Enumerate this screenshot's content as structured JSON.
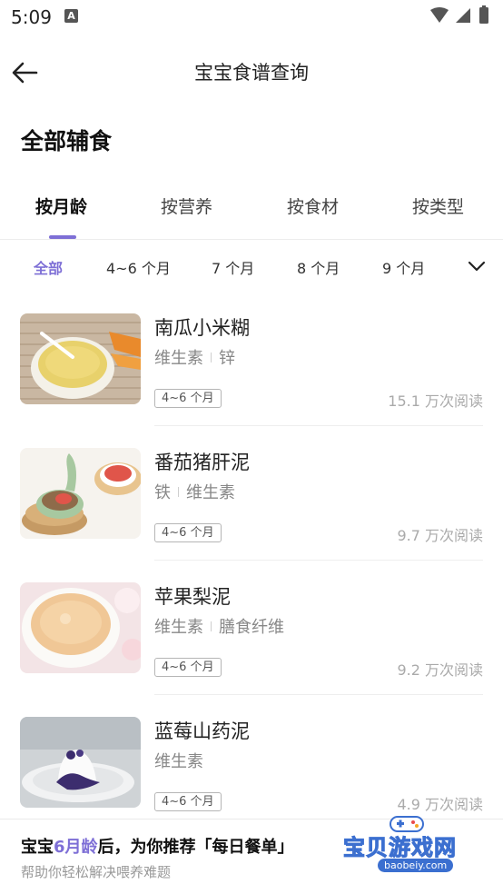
{
  "status_bar": {
    "time": "5:09",
    "notification_icon": "A"
  },
  "header": {
    "title": "宝宝食谱查询"
  },
  "section_title": "全部辅食",
  "tabs": [
    {
      "label": "按月龄",
      "active": true
    },
    {
      "label": "按营养",
      "active": false
    },
    {
      "label": "按食材",
      "active": false
    },
    {
      "label": "按类型",
      "active": false
    }
  ],
  "age_filters": [
    {
      "label": "全部",
      "active": true
    },
    {
      "label": "4~6 个月",
      "active": false
    },
    {
      "label": "7 个月",
      "active": false
    },
    {
      "label": "8 个月",
      "active": false
    },
    {
      "label": "9 个月",
      "active": false
    }
  ],
  "recipes": [
    {
      "name": "南瓜小米糊",
      "tags": [
        "维生素",
        "锌"
      ],
      "age": "4~6 个月",
      "reads": "15.1 万次阅读"
    },
    {
      "name": "番茄猪肝泥",
      "tags": [
        "铁",
        "维生素"
      ],
      "age": "4~6 个月",
      "reads": "9.7 万次阅读"
    },
    {
      "name": "苹果梨泥",
      "tags": [
        "维生素",
        "膳食纤维"
      ],
      "age": "4~6 个月",
      "reads": "9.2 万次阅读"
    },
    {
      "name": "蓝莓山药泥",
      "tags": [
        "维生素"
      ],
      "age": "4~6 个月",
      "reads": "4.9 万次阅读"
    }
  ],
  "banner": {
    "headline_prefix": "宝宝",
    "headline_accent": "6月龄",
    "headline_suffix": "后，为你推荐「每日餐单」",
    "subtitle": "帮助你轻松解决喂养难题"
  },
  "watermark": {
    "text": "宝贝游戏网",
    "url": "baobeiy.com"
  },
  "colors": {
    "accent": "#7e6fd6"
  }
}
